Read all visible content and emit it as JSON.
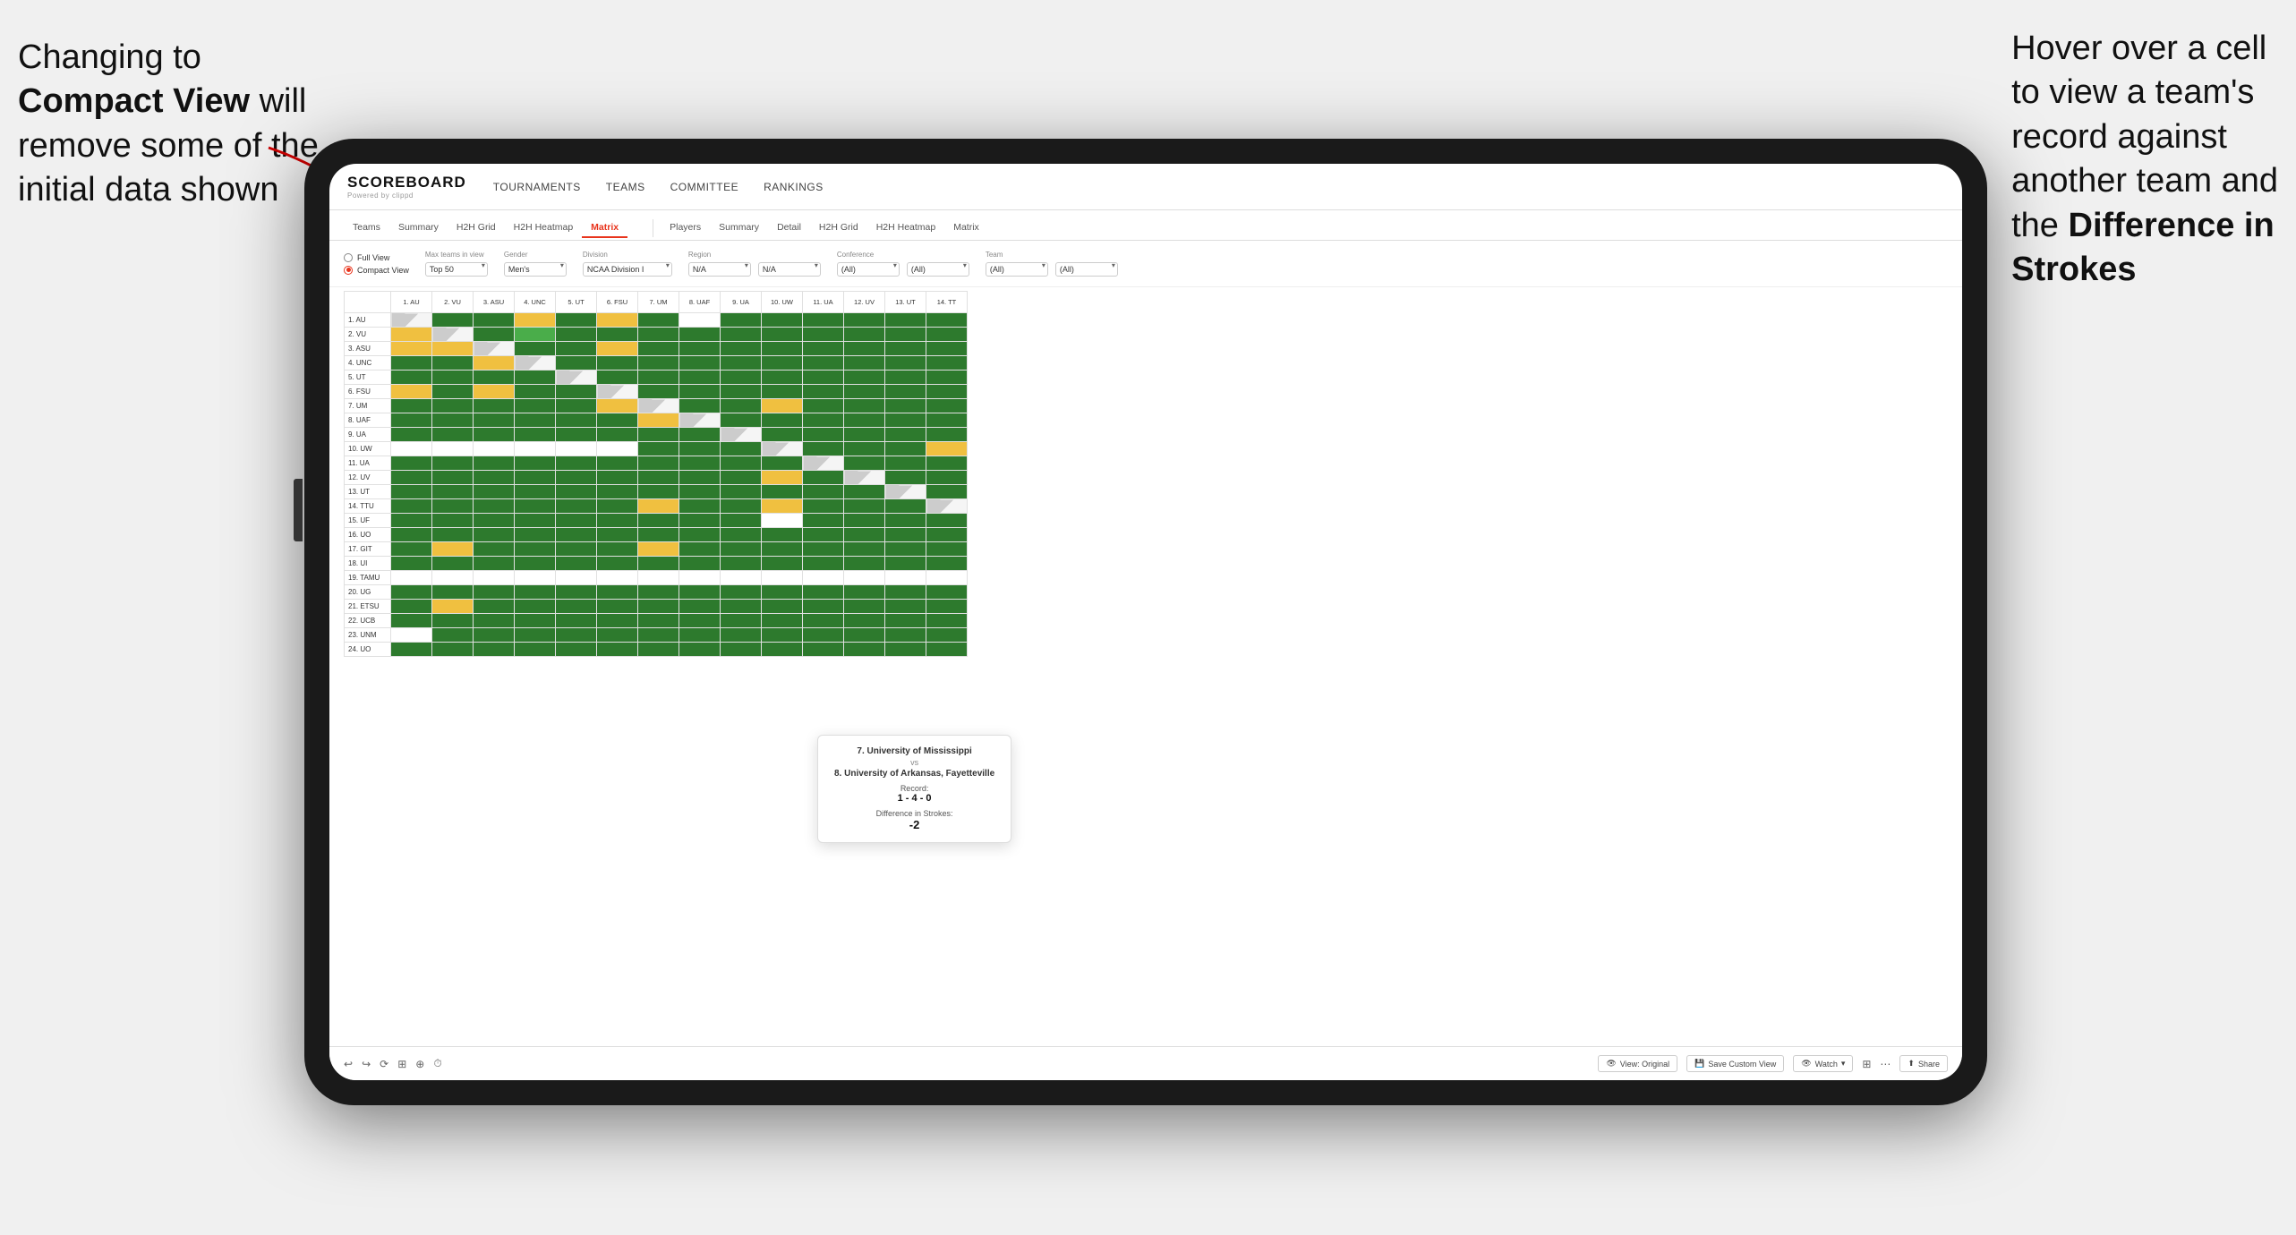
{
  "annotations": {
    "left_text_line1": "Changing to",
    "left_text_line2": "Compact View",
    "left_text_line3": "will",
    "left_text_line4": "remove some of the",
    "left_text_line5": "initial data shown",
    "right_text_line1": "Hover over a cell",
    "right_text_line2": "to view a team's",
    "right_text_line3": "record against",
    "right_text_line4": "another team and",
    "right_text_line5": "the",
    "right_text_bold": "Difference in",
    "right_text_bold2": "Strokes"
  },
  "nav": {
    "logo": "SCOREBOARD",
    "logo_sub": "Powered by clippd",
    "items": [
      "TOURNAMENTS",
      "TEAMS",
      "COMMITTEE",
      "RANKINGS"
    ]
  },
  "sub_tabs_left": [
    "Teams",
    "Summary",
    "H2H Grid",
    "H2H Heatmap",
    "Matrix"
  ],
  "sub_tabs_right": [
    "Players",
    "Summary",
    "Detail",
    "H2H Grid",
    "H2H Heatmap",
    "Matrix"
  ],
  "filters": {
    "view_full": "Full View",
    "view_compact": "Compact View",
    "max_teams_label": "Max teams in view",
    "max_teams_value": "Top 50",
    "gender_label": "Gender",
    "gender_value": "Men's",
    "division_label": "Division",
    "division_value": "NCAA Division I",
    "region_label": "Region",
    "region_value1": "N/A",
    "region_value2": "N/A",
    "conference_label": "Conference",
    "conference_value1": "(All)",
    "conference_value2": "(All)",
    "team_label": "Team",
    "team_value1": "(All)",
    "team_value2": "(All)"
  },
  "col_headers": [
    "1. AU",
    "2. VU",
    "3. ASU",
    "4. UNC",
    "5. UT",
    "6. FSU",
    "7. UM",
    "8. UAF",
    "9. UA",
    "10. UW",
    "11. UA",
    "12. UV",
    "13. UT",
    "14. TT"
  ],
  "row_headers": [
    "1. AU",
    "2. VU",
    "3. ASU",
    "4. UNC",
    "5. UT",
    "6. FSU",
    "7. UM",
    "8. UAF",
    "9. UA",
    "10. UW",
    "11. UA",
    "12. UV",
    "13. UT",
    "14. TTU",
    "15. UF",
    "16. UO",
    "17. GIT",
    "18. UI",
    "19. TAMU",
    "20. UG",
    "21. ETSU",
    "22. UCB",
    "23. UNM",
    "24. UO"
  ],
  "tooltip": {
    "team1": "7. University of Mississippi",
    "vs": "vs",
    "team2": "8. University of Arkansas, Fayetteville",
    "record_label": "Record:",
    "record_value": "1 - 4 - 0",
    "strokes_label": "Difference in Strokes:",
    "strokes_value": "-2"
  },
  "toolbar": {
    "view_original": "View: Original",
    "save_custom": "Save Custom View",
    "watch": "Watch",
    "share": "Share"
  }
}
